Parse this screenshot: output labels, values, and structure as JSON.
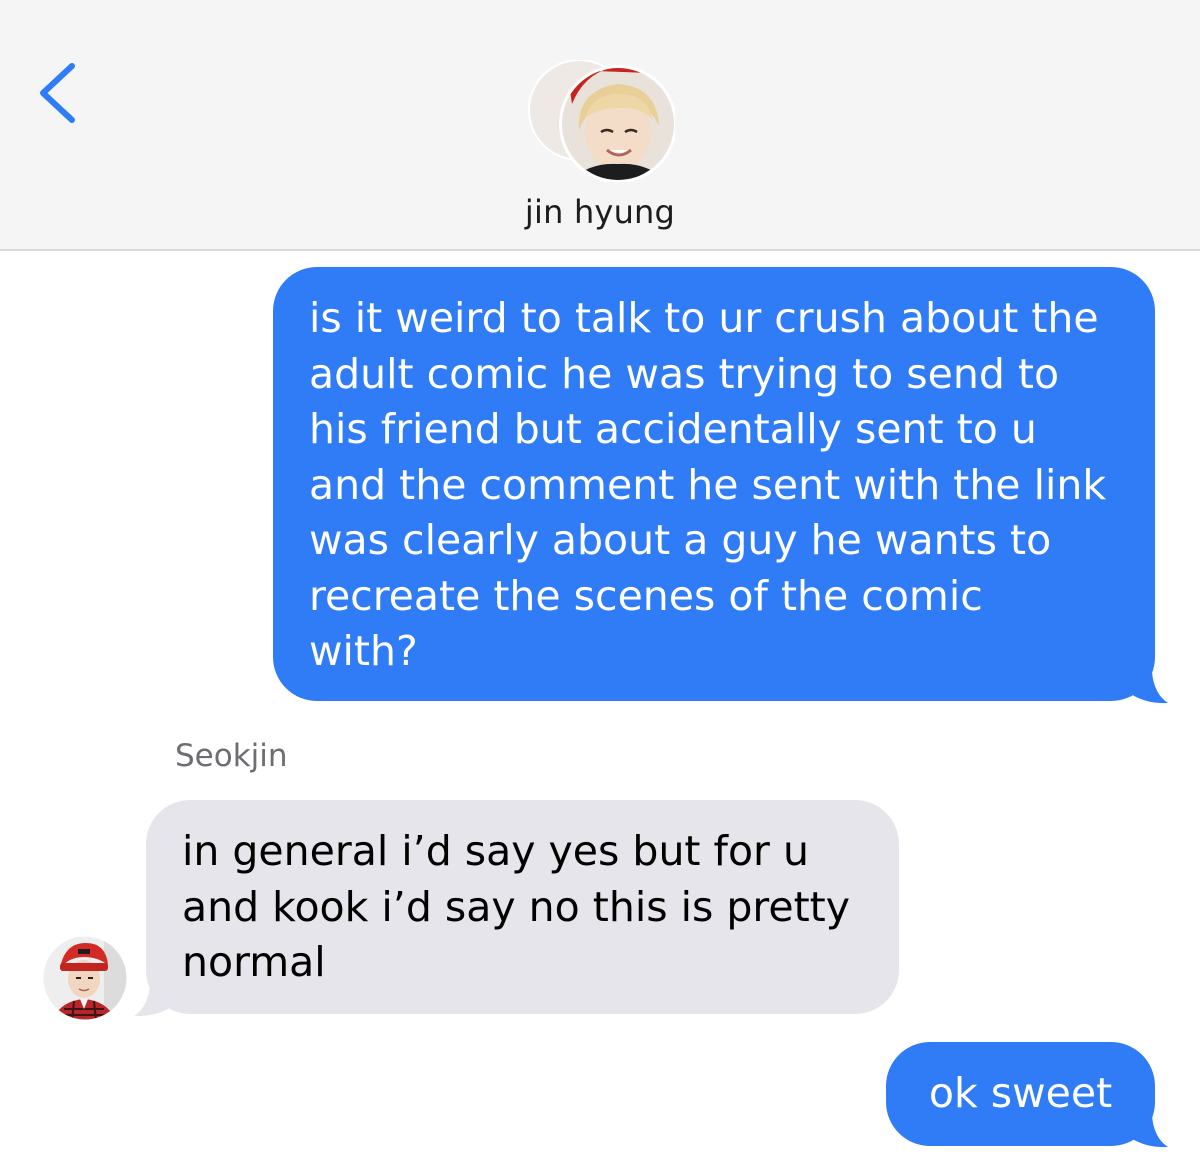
{
  "header": {
    "back_icon": "chevron-left-icon",
    "contact_name": "jin hyung",
    "accent_color": "#2f7cf6"
  },
  "messages": [
    {
      "direction": "outgoing",
      "lines": [
        "is it weird to talk to ur crush about the",
        "adult comic he was trying to send to",
        "his friend but accidentally sent to u",
        "and the comment he sent with the link",
        "was clearly about a guy he wants to",
        "recreate the scenes of the comic",
        "with?"
      ]
    },
    {
      "direction": "incoming",
      "sender": "Seokjin",
      "lines": [
        "in general i’d say yes but for u",
        "and kook i’d say no this is pretty",
        "normal"
      ]
    },
    {
      "direction": "outgoing",
      "lines": [
        "ok sweet"
      ]
    }
  ],
  "colors": {
    "outgoing_bubble": "#2f7cf6",
    "incoming_bubble": "#e6e5eb",
    "header_bg": "#f5f5f6"
  }
}
